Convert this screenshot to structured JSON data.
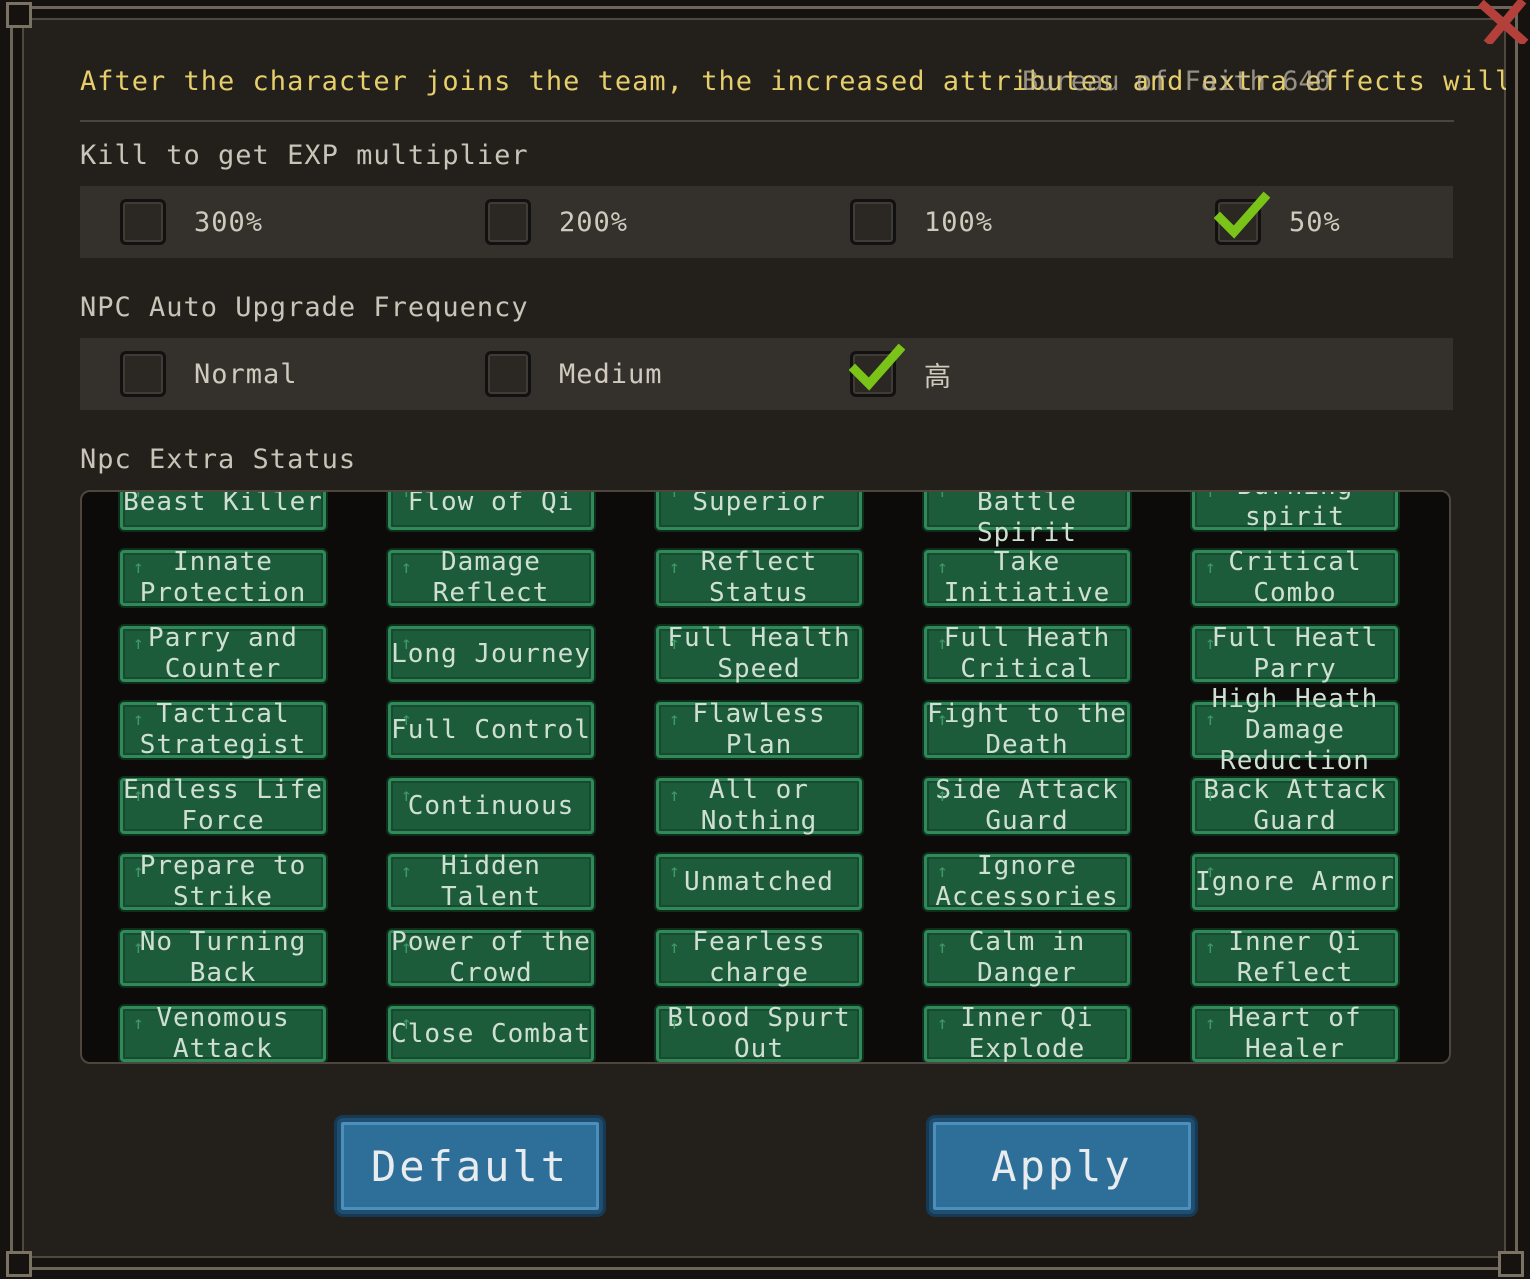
{
  "notice": "After the character joins the team, the increased attributes and extra effects will b",
  "notice_overlay": "Bureau of Faith 640",
  "sections": {
    "exp": {
      "label": "Kill to get EXP multiplier",
      "options": [
        {
          "label": "300%",
          "checked": false
        },
        {
          "label": "200%",
          "checked": false
        },
        {
          "label": "100%",
          "checked": false
        },
        {
          "label": "50%",
          "checked": true
        }
      ]
    },
    "upgrade": {
      "label": "NPC Auto Upgrade Frequency",
      "options": [
        {
          "label": "Normal",
          "checked": false
        },
        {
          "label": "Medium",
          "checked": false
        },
        {
          "label": "高",
          "checked": true
        }
      ]
    },
    "extra": {
      "label": "Npc Extra Status"
    }
  },
  "status_tags": [
    "Beast Killer",
    "Flow of Qi",
    "Superior",
    "Inciting Battle Spirit",
    "Burning spirit",
    "Innate Protection",
    "Damage Reflect",
    "Reflect Status",
    "Take Initiative",
    "Critical Combo",
    "Parry and Counter",
    "Long Journey",
    "Full Health Speed",
    "Full Heath Critical",
    "Full Heatl Parry",
    "Tactical Strategist",
    "Full Control",
    "Flawless Plan",
    "Fight to the Death",
    "High Heath Damage Reduction",
    "Endless Life Force",
    "Continuous",
    "All or Nothing",
    "Side Attack Guard",
    "Back Attack Guard",
    "Prepare to Strike",
    "Hidden Talent",
    "Unmatched",
    "Ignore Accessories",
    "Ignore Armor",
    "No Turning Back",
    "Power of the Crowd",
    "Fearless charge",
    "Calm in Danger",
    "Inner Qi Reflect",
    "Venomous Attack",
    "Close Combat",
    "Blood Spurt Out",
    "Inner Qi Explode",
    "Heart of Healer"
  ],
  "buttons": {
    "default": "Default",
    "apply": "Apply"
  },
  "colors": {
    "notice": "#e6cf6a",
    "check": "#7ac41a",
    "tag_bg": "#1d5c3b",
    "button_bg": "#2e6f9a"
  }
}
